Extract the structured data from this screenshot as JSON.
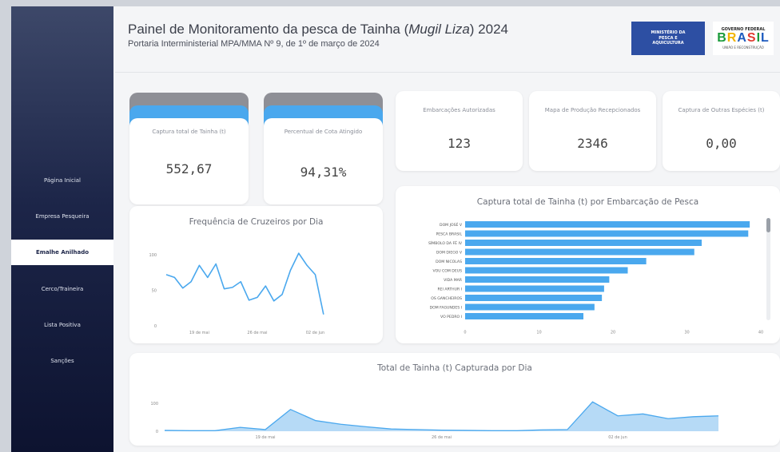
{
  "header": {
    "title_pre": "Painel de Monitoramento da pesca de Tainha (",
    "title_species": "Mugil Liza",
    "title_post": ") 2024",
    "subtitle": "Portaria Interministerial MPA/MMA Nº 9, de 1º de março de 2024"
  },
  "logos": {
    "mpa": [
      "MINISTÉRIO DA",
      "PESCA E",
      "AQUICULTURA"
    ],
    "gov_top": "GOVERNO FEDERAL",
    "gov_big": "BRASIL",
    "gov_bottom": "UNIÃO E RECONSTRUÇÃO"
  },
  "sidebar": {
    "items": [
      {
        "label": "Página Inicial",
        "active": false
      },
      {
        "label": "Empresa Pesqueira",
        "active": false
      },
      {
        "label": "Emalhe Anilhado",
        "active": true
      },
      {
        "label": "Cerco/Traineira",
        "active": false
      },
      {
        "label": "Lista Positiva",
        "active": false
      },
      {
        "label": "Sanções",
        "active": false
      }
    ]
  },
  "kpis": {
    "captura_total": {
      "label": "Captura total de Tainha (t)",
      "value": "552,67"
    },
    "percentual_cota": {
      "label": "Percentual de Cota Atingido",
      "value": "94,31%"
    },
    "embarcacoes": {
      "label": "Embarcações Autorizadas",
      "value": "123"
    },
    "mapas": {
      "label": "Mapa de Produção Recepcionados",
      "value": "2346"
    },
    "outras_especies": {
      "label": "Captura de Outras Espécies (t)",
      "value": "0,00"
    }
  },
  "colors": {
    "accent": "#4aa8ee",
    "line": "#4aa8ee",
    "area_fill": "#a9d4f5",
    "sidebar": "#1c2548"
  },
  "chart_data": [
    {
      "type": "line",
      "title": "Frequência de Cruzeiros por Dia",
      "ylim": [
        0,
        110
      ],
      "yticks": [
        0,
        50,
        100
      ],
      "xlim": [
        0,
        25
      ],
      "x_ticks": [
        {
          "x": 4,
          "label": "19 de mai"
        },
        {
          "x": 11,
          "label": "26 de mai"
        },
        {
          "x": 18,
          "label": "02 de jun"
        }
      ],
      "x": [
        0,
        1,
        2,
        3,
        4,
        5,
        6,
        7,
        8,
        9,
        10,
        11,
        12,
        13,
        14,
        15,
        16,
        17,
        18,
        19,
        20
      ],
      "values": [
        72,
        68,
        53,
        62,
        85,
        68,
        87,
        52,
        54,
        62,
        36,
        40,
        56,
        35,
        44,
        78,
        102,
        85,
        72,
        16,
        null
      ],
      "grid": false
    },
    {
      "type": "bar",
      "orientation": "horizontal",
      "title": "Captura total de Tainha (t) por Embarcação de Pesca",
      "categories": [
        "DOM JOSÉ V",
        "PESCA BRASIL",
        "SÍMBOLO DA FÉ IV",
        "DOM DIEGO V",
        "DOM NICOLAS",
        "VOU COM DEUS",
        "VIDA MAR",
        "REI ARTHUR I",
        "OS GANCHEIROS",
        "DOM FAGUNDES I",
        "VO PEDRO I"
      ],
      "values": [
        38.5,
        38.3,
        32,
        31,
        24.5,
        22,
        19.5,
        18.8,
        18.5,
        17.5,
        16
      ],
      "xlim": [
        0,
        40
      ],
      "xticks": [
        0,
        10,
        20,
        30,
        40
      ],
      "grid": false
    },
    {
      "type": "area",
      "title": "Total de Tainha (t) Capturada por Dia",
      "ylim": [
        0,
        120
      ],
      "yticks": [
        0,
        100
      ],
      "xlim": [
        0,
        24
      ],
      "x_ticks": [
        {
          "x": 4,
          "label": "19 de mai"
        },
        {
          "x": 11,
          "label": "26 de mai"
        },
        {
          "x": 18,
          "label": "02 de jun"
        }
      ],
      "x": [
        0,
        1,
        2,
        3,
        4,
        5,
        6,
        7,
        8,
        9,
        10,
        11,
        12,
        13,
        14,
        15,
        16,
        17,
        18,
        19,
        20,
        21,
        22
      ],
      "values": [
        3,
        2,
        2,
        14,
        6,
        78,
        38,
        25,
        16,
        8,
        6,
        4,
        3,
        2,
        2,
        5,
        6,
        105,
        55,
        62,
        45,
        52,
        55
      ],
      "grid": false
    }
  ]
}
